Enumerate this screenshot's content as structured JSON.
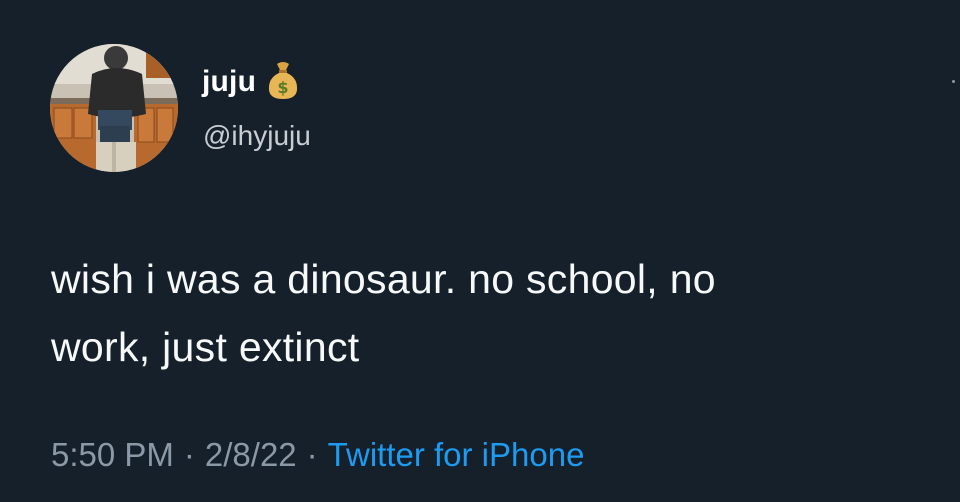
{
  "tweet": {
    "author": {
      "display_name": "juju",
      "name_emoji": "moneybag-icon",
      "handle": "@ihyjuju"
    },
    "text_line1": "wish i was a dinosaur. no school, no",
    "text_line2": "work, just extinct",
    "meta": {
      "time": "5:50 PM",
      "separator": "·",
      "date": "2/8/22",
      "source": "Twitter for iPhone"
    }
  },
  "colors": {
    "background": "#15202b",
    "text": "#f7f9f9",
    "secondary": "#8b98a5",
    "link": "#1d9bf0"
  }
}
